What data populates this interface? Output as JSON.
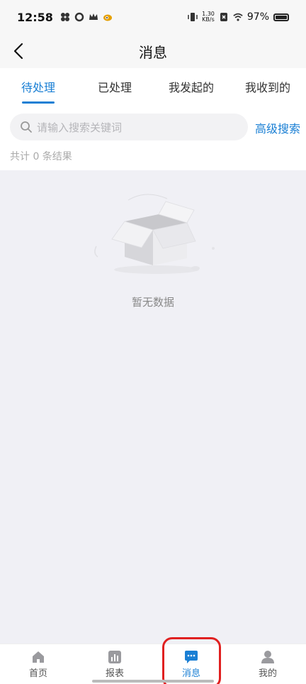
{
  "status_bar": {
    "time": "12:58",
    "battery": "97%",
    "net_speed_top": "1.30",
    "net_speed_bottom": "KB/s"
  },
  "nav": {
    "title": "消息"
  },
  "tabs": [
    {
      "label": "待处理",
      "active": true
    },
    {
      "label": "已处理",
      "active": false
    },
    {
      "label": "我发起的",
      "active": false
    },
    {
      "label": "我收到的",
      "active": false
    }
  ],
  "search": {
    "placeholder": "请输入搜索关键词",
    "advanced_label": "高级搜索"
  },
  "result_count": "共计 0 条结果",
  "empty": {
    "text": "暂无数据"
  },
  "tabbar": [
    {
      "label": "首页",
      "icon": "home-icon",
      "active": false
    },
    {
      "label": "报表",
      "icon": "chart-icon",
      "active": false
    },
    {
      "label": "消息",
      "icon": "message-icon",
      "active": true
    },
    {
      "label": "我的",
      "icon": "user-icon",
      "active": false
    }
  ],
  "colors": {
    "accent": "#1a7fd4",
    "highlight": "#e02020"
  }
}
